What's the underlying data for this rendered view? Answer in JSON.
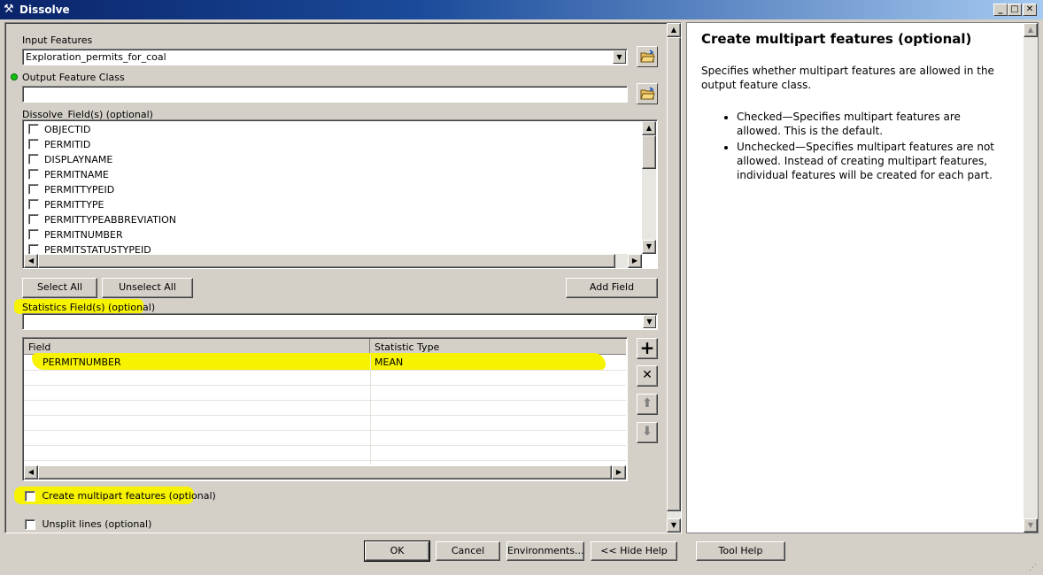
{
  "window": {
    "title": "Dissolve"
  },
  "form": {
    "input_features": {
      "label": "Input Features",
      "value": "Exploration_permits_for_coal"
    },
    "output_feature_class": {
      "label": "Output Feature Class",
      "value": ""
    },
    "dissolve_fields": {
      "label": "Dissolve_Field(s) (optional)",
      "items": [
        "OBJECTID",
        "PERMITID",
        "DISPLAYNAME",
        "PERMITNAME",
        "PERMITTYPEID",
        "PERMITTYPE",
        "PERMITTYPEABBREVIATION",
        "PERMITNUMBER",
        "PERMITSTATUSTYPEID"
      ]
    },
    "select_all": "Select All",
    "unselect_all": "Unselect All",
    "add_field": "Add Field",
    "statistics_fields": {
      "label": "Statistics Field(s) (optional)",
      "value": "",
      "columns": [
        "Field",
        "Statistic Type"
      ],
      "rows": [
        {
          "field": "PERMITNUMBER",
          "statistic": "MEAN"
        }
      ]
    },
    "multipart": {
      "label": "Create multipart features (optional)",
      "checked": false
    },
    "unsplit": {
      "label": "Unsplit lines (optional)",
      "checked": false
    }
  },
  "help": {
    "title": "Create multipart features (optional)",
    "description": "Specifies whether multipart features are allowed in the output feature class.",
    "bullets": [
      "Checked—Specifies multipart features are allowed. This is the default.",
      "Unchecked—Specifies multipart features are not allowed. Instead of creating multipart features, individual features will be created for each part."
    ]
  },
  "footer": {
    "ok": "OK",
    "cancel": "Cancel",
    "environments": "Environments...",
    "hide_help": "<< Hide Help",
    "tool_help": "Tool Help"
  },
  "colors": {
    "highlight": "#f6f200",
    "titlebar": "#0a246a"
  }
}
